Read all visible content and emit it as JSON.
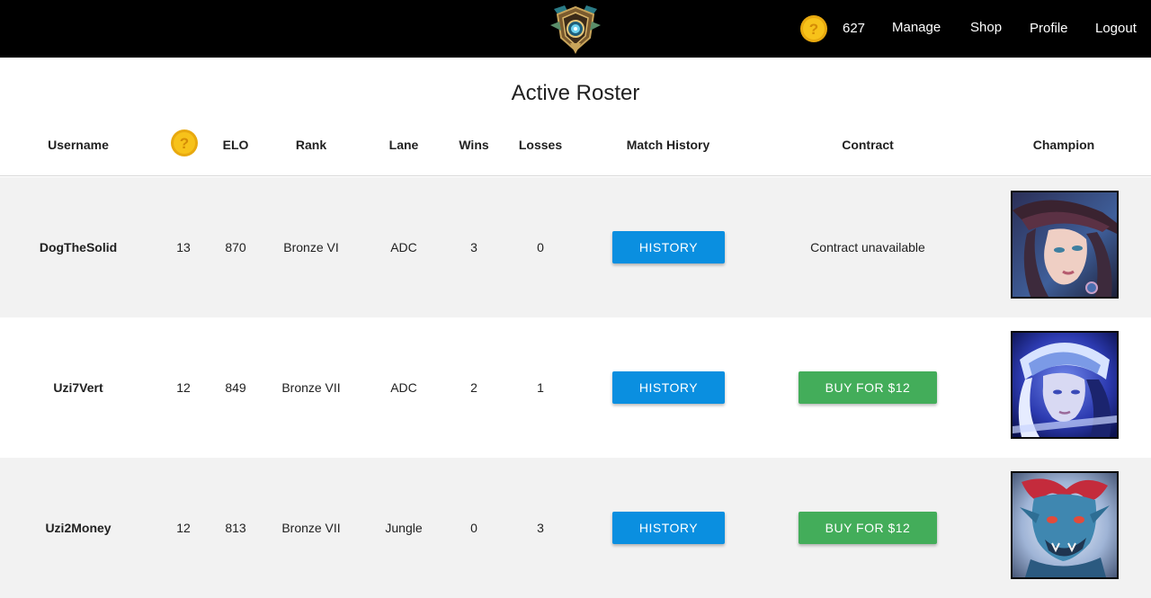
{
  "nav": {
    "coins": "627",
    "links": [
      "Manage",
      "Shop",
      "Profile",
      "Logout"
    ]
  },
  "page_title": "Active Roster",
  "columns": [
    "Username",
    "",
    "ELO",
    "Rank",
    "Lane",
    "Wins",
    "Losses",
    "Match History",
    "Contract",
    "Champion"
  ],
  "rows": [
    {
      "username": "DogTheSolid",
      "coins": "13",
      "elo": "870",
      "rank": "Bronze VI",
      "lane": "ADC",
      "wins": "3",
      "losses": "0",
      "history_label": "HISTORY",
      "contract": "Contract unavailable",
      "contract_button": null,
      "champion_icon": "champion-portrait-hat-icon"
    },
    {
      "username": "Uzi7Vert",
      "coins": "12",
      "elo": "849",
      "rank": "Bronze VII",
      "lane": "ADC",
      "wins": "2",
      "losses": "1",
      "history_label": "HISTORY",
      "contract": null,
      "contract_button": "BUY FOR $12",
      "champion_icon": "champion-portrait-hood-icon"
    },
    {
      "username": "Uzi2Money",
      "coins": "12",
      "elo": "813",
      "rank": "Bronze VII",
      "lane": "Jungle",
      "wins": "0",
      "losses": "3",
      "history_label": "HISTORY",
      "contract": null,
      "contract_button": "BUY FOR $12",
      "champion_icon": "champion-portrait-troll-icon"
    }
  ],
  "colors": {
    "navbar": "#000000",
    "history_button": "#0a8fe0",
    "buy_button": "#43ad5a",
    "row_shade": "#f2f2f2",
    "coin": "#f7c21a"
  }
}
